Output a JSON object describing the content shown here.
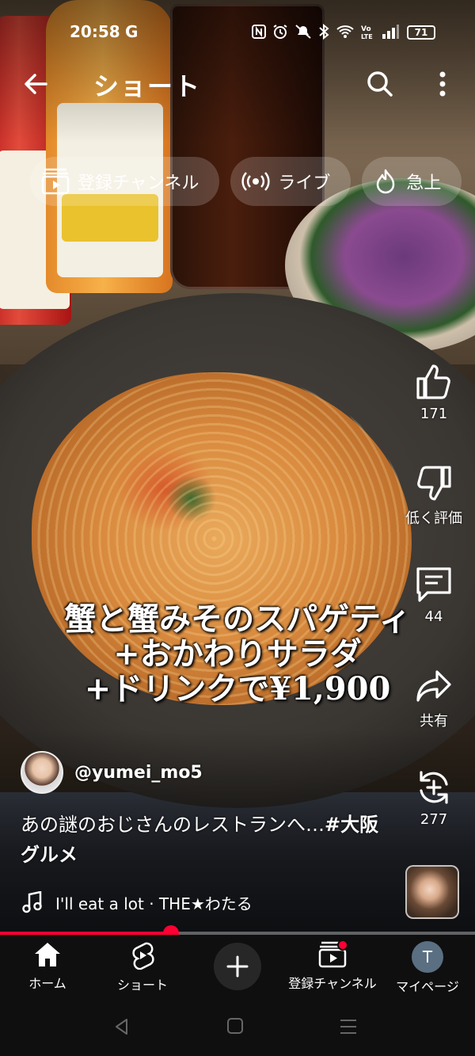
{
  "status_bar": {
    "time": "20:58",
    "carrier_icon": "G",
    "icons": [
      "nfc-icon",
      "alarm-icon",
      "mute-icon",
      "bluetooth-icon",
      "wifi-icon",
      "volte-icon",
      "signal-icon"
    ],
    "battery": "71"
  },
  "topbar": {
    "title": "ショート",
    "back_icon": "arrow-left-icon",
    "search_icon": "search-icon",
    "more_icon": "more-vertical-icon"
  },
  "chips": [
    {
      "label": "登録チャンネル",
      "icon": "subscriptions-icon"
    },
    {
      "label": "ライブ",
      "icon": "live-icon"
    },
    {
      "label": "急上",
      "icon": "trending-icon"
    }
  ],
  "video": {
    "caption_lines": [
      "蟹と蟹みそのスパゲティ",
      "+おかわりサラダ",
      "+ドリンクで¥1,900"
    ]
  },
  "actions": {
    "like_count": "171",
    "dislike_label": "低く評価",
    "comment_count": "44",
    "share_label": "共有",
    "remix_count": "277"
  },
  "channel": {
    "handle": "@yumei_mo5"
  },
  "description": {
    "text": "あの謎のおじさんのレストランへ…",
    "hashtag": "#大阪グルメ"
  },
  "music": {
    "title": "I'll eat a lot · THE★わたる"
  },
  "progress": {
    "fraction": 0.36
  },
  "colors": {
    "accent": "#ff0033",
    "nav_background": "#0f0f0f"
  },
  "bottom_nav": {
    "home": "ホーム",
    "shorts": "ショート",
    "subscriptions": "登録チャンネル",
    "mypage": "マイページ",
    "avatar_letter": "T"
  }
}
